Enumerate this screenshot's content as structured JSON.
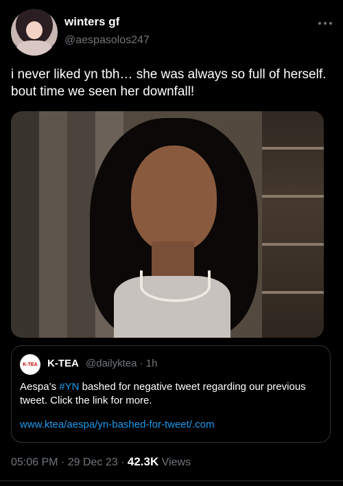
{
  "author": {
    "display_name": "winters gf",
    "handle": "@aespasolos247"
  },
  "tweet": {
    "text": "i never liked yn tbh… she was always so full of herself. bout time we seen her downfall!"
  },
  "quote": {
    "avatar_text": "K-TEA",
    "display_name": "K-TEA",
    "handle_time": "@dailyktea · 1h",
    "text_before": "Aespa’s ",
    "hashtag": "#YN",
    "text_after": " bashed for negative tweet regarding our previous tweet. Click the link for more.",
    "link": "www.ktea/aespa/yn-bashed-for-tweet/.com"
  },
  "meta": {
    "timestamp": "05:06 PM · 29 Dec 23 · ",
    "views_count": "42.3K",
    "views_label": " Views"
  },
  "colors": {
    "background": "#000000",
    "text": "#e7e9ea",
    "secondary": "#71767b",
    "accent": "#1d9bf0",
    "border": "#2f3336"
  }
}
